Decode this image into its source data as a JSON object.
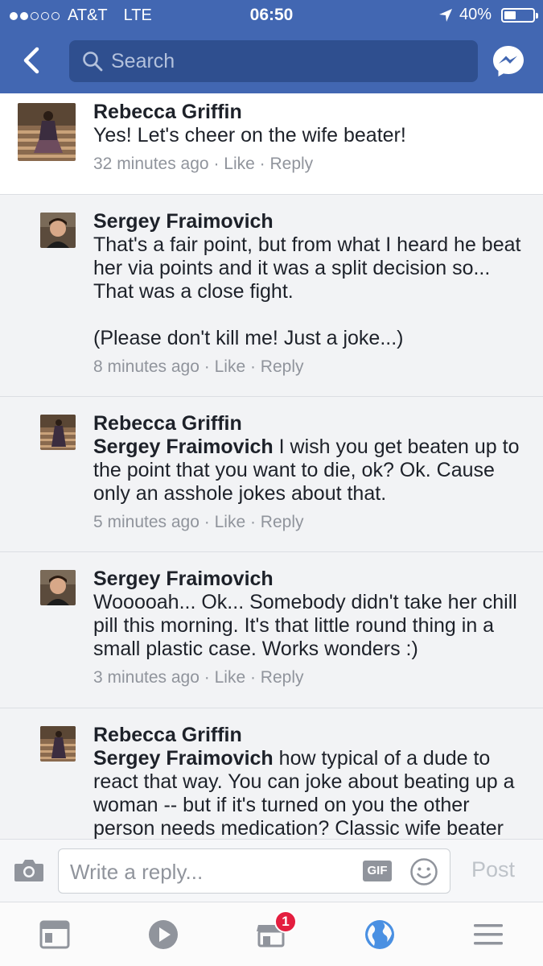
{
  "status_bar": {
    "carrier": "AT&T",
    "network": "LTE",
    "time": "06:50",
    "battery": "40%",
    "battery_level": 0.4
  },
  "header": {
    "search_placeholder": "Search"
  },
  "comments": [
    {
      "author": "Rebecca Griffin",
      "mention": "",
      "text": "Yes! Let's cheer on the wife beater!",
      "time": "32 minutes ago",
      "like_label": "Like",
      "reply_label": "Reply"
    },
    {
      "author": "Sergey Fraimovich",
      "mention": "",
      "text": "That's a fair point, but from what I heard he beat her via points and it was a split decision so... That was a close fight.\n\n(Please don't kill me! Just a joke...)",
      "time": "8 minutes ago",
      "like_label": "Like",
      "reply_label": "Reply"
    },
    {
      "author": "Rebecca Griffin",
      "mention": "Sergey Fraimovich",
      "text": " I wish you get beaten up to the point that you want to die, ok? Ok. Cause only an asshole jokes about that.",
      "time": "5 minutes ago",
      "like_label": "Like",
      "reply_label": "Reply"
    },
    {
      "author": "Sergey Fraimovich",
      "mention": "",
      "text": "Wooooah... Ok... Somebody didn't take her chill pill this morning. It's that little round thing in a small plastic case. Works wonders :)",
      "time": "3 minutes ago",
      "like_label": "Like",
      "reply_label": "Reply"
    },
    {
      "author": "Rebecca Griffin",
      "mention": "Sergey Fraimovich",
      "text": " how typical of a dude to react that way. You can joke about beating up a woman -- but if it's turned on you the other person needs medication? Classic wife beater",
      "time": "",
      "like_label": "",
      "reply_label": ""
    }
  ],
  "composer": {
    "placeholder": "Write a reply...",
    "gif_label": "GIF",
    "post_label": "Post"
  },
  "tabbar": {
    "marketplace_badge": "1"
  },
  "colors": {
    "brand_blue": "#4267b2",
    "search_bg": "#2f4f8f",
    "meta_gray": "#90949c",
    "badge_red": "#e41e3f",
    "globe_blue": "#4a90e2"
  }
}
